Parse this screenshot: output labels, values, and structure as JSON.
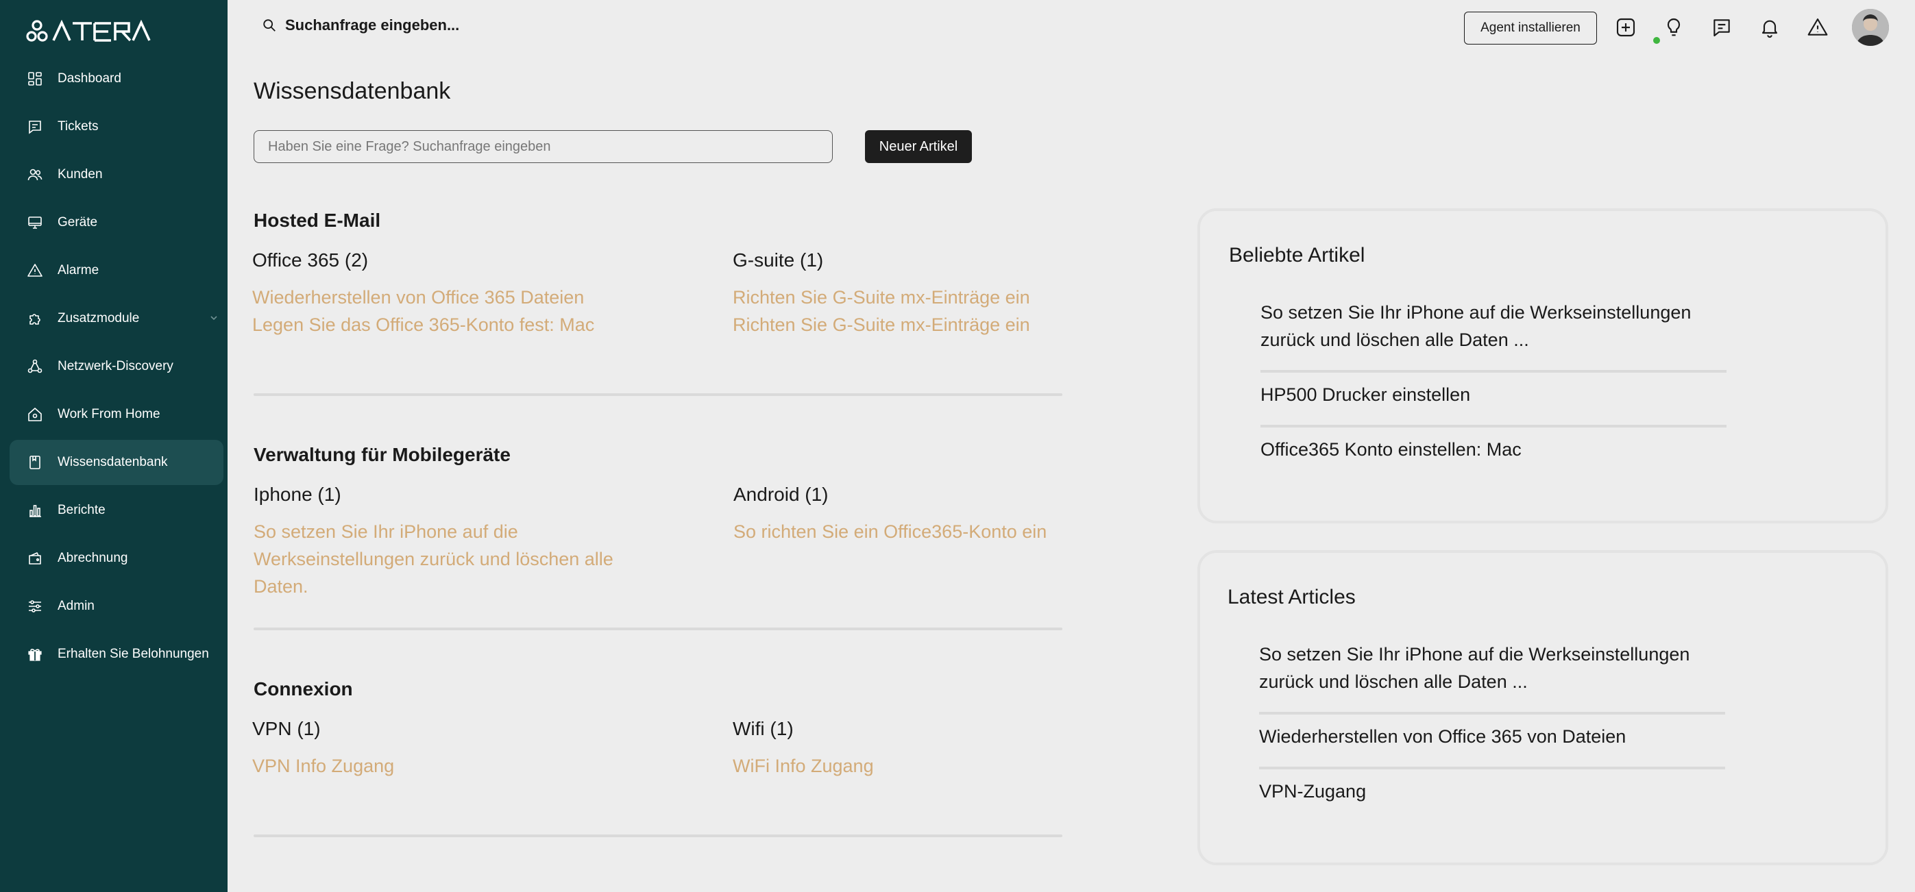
{
  "brand": {
    "logo_text": "ATERA"
  },
  "sidebar": {
    "items": [
      {
        "label": "Dashboard",
        "icon": "dashboard-icon"
      },
      {
        "label": "Tickets",
        "icon": "ticket-icon"
      },
      {
        "label": "Kunden",
        "icon": "users-icon"
      },
      {
        "label": "Geräte",
        "icon": "monitor-icon"
      },
      {
        "label": "Alarme",
        "icon": "alert-icon"
      },
      {
        "label": "Zusatzmodule",
        "icon": "puzzle-icon"
      },
      {
        "label": "Netzwerk-Discovery",
        "icon": "network-icon"
      },
      {
        "label": "Work From Home",
        "icon": "home-icon"
      },
      {
        "label": "Wissensdatenbank",
        "icon": "book-icon"
      },
      {
        "label": "Berichte",
        "icon": "bar-chart-icon"
      },
      {
        "label": "Abrechnung",
        "icon": "wallet-icon"
      },
      {
        "label": "Admin",
        "icon": "sliders-icon"
      },
      {
        "label": "Erhalten Sie Belohnungen",
        "icon": "gift-icon"
      }
    ]
  },
  "topbar": {
    "search_label": "Suchanfrage eingeben...",
    "agent_button": "Agent installieren",
    "icons": [
      "plus-square-icon",
      "lightbulb-icon",
      "chat-icon",
      "bell-icon",
      "warning-icon"
    ]
  },
  "page": {
    "title": "Wissensdatenbank",
    "search_placeholder": "Haben Sie eine Frage? Suchanfrage eingeben",
    "new_button": "Neuer Artikel"
  },
  "sections": [
    {
      "title": "Hosted E-Mail",
      "categories": [
        {
          "name": "Office 365 (2)",
          "links": [
            "Wiederherstellen von Office 365 Dateien",
            "Legen Sie das Office 365-Konto fest: Mac"
          ]
        },
        {
          "name": "G-suite (1)",
          "links": [
            "Richten Sie G-Suite mx-Einträge ein",
            "Richten Sie G-Suite mx-Einträge ein"
          ]
        }
      ]
    },
    {
      "title": "Verwaltung für Mobilegeräte",
      "categories": [
        {
          "name": "Iphone (1)",
          "links": [
            "So setzen Sie Ihr iPhone auf die",
            "Werkseinstellungen zurück und löschen alle",
            "Daten."
          ]
        },
        {
          "name": "Android (1)",
          "links": [
            "So richten Sie ein Office365-Konto ein"
          ]
        }
      ]
    },
    {
      "title": "Connexion",
      "categories": [
        {
          "name": "VPN (1)",
          "links": [
            "VPN Info Zugang"
          ]
        },
        {
          "name": "Wifi (1)",
          "links": [
            "WiFi Info Zugang"
          ]
        }
      ]
    }
  ],
  "popular": {
    "title": "Beliebte Artikel",
    "items": [
      [
        "So setzen Sie Ihr iPhone auf die Werkseinstellungen",
        "zurück und löschen alle Daten ..."
      ],
      [
        "HP500 Drucker einstellen"
      ],
      [
        "Office365 Konto einstellen: Mac"
      ]
    ]
  },
  "latest": {
    "title": "Latest Articles",
    "items": [
      [
        "So setzen Sie Ihr iPhone auf die Werkseinstellungen",
        "zurück und löschen alle Daten ..."
      ],
      [
        "Wiederherstellen von Office 365 von Dateien"
      ],
      [
        "VPN-Zugang"
      ]
    ]
  },
  "colors": {
    "sidebar_bg": "#0d3b3e",
    "sidebar_active": "#1d4e51",
    "link": "#d3ab78",
    "background": "#ededed",
    "status_online": "#3fb63f"
  }
}
